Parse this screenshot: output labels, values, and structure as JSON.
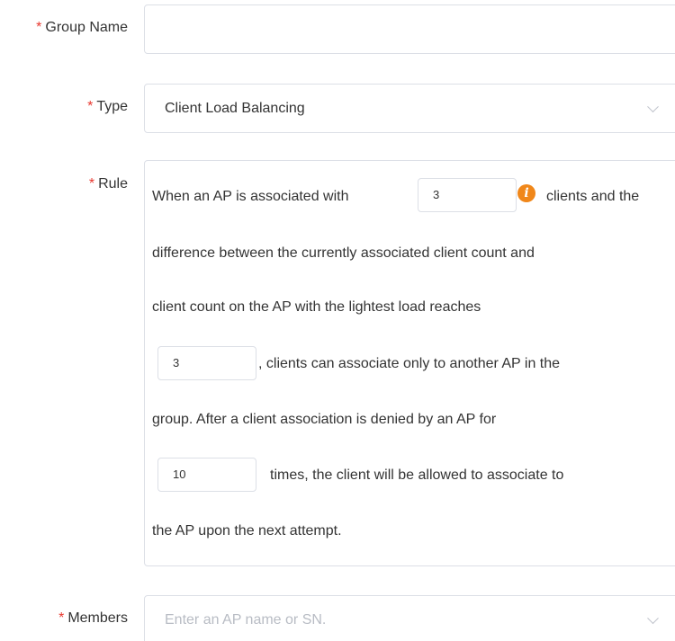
{
  "form": {
    "required_mark": "*",
    "group_name": {
      "label": "Group Name",
      "value": ""
    },
    "type": {
      "label": "Type",
      "value": "Client Load Balancing"
    },
    "rule": {
      "label": "Rule",
      "line1_text": "When an AP is associated with",
      "clients_threshold": "3",
      "line1_suffix": "clients and the",
      "line2_text": "difference between the currently associated client count and",
      "line3_text": "client count on the AP with the lightest load reaches",
      "difference_threshold": "3",
      "line4_suffix": ", clients can associate only to another AP in the",
      "line5_text": "group. After a client association is denied by an AP for",
      "deny_times": "10",
      "line6_suffix": "times, the client will be allowed to associate to",
      "line7_text": "the AP upon the next attempt."
    },
    "members": {
      "label": "Members",
      "placeholder": "Enter an AP name or SN."
    }
  },
  "icons": {
    "info": "info-icon",
    "dropdown": "chevron-down-icon"
  },
  "colors": {
    "required": "#e8382f",
    "info_icon": "#f0871a",
    "border": "#dcdfe6",
    "placeholder": "#b8bcc4"
  }
}
